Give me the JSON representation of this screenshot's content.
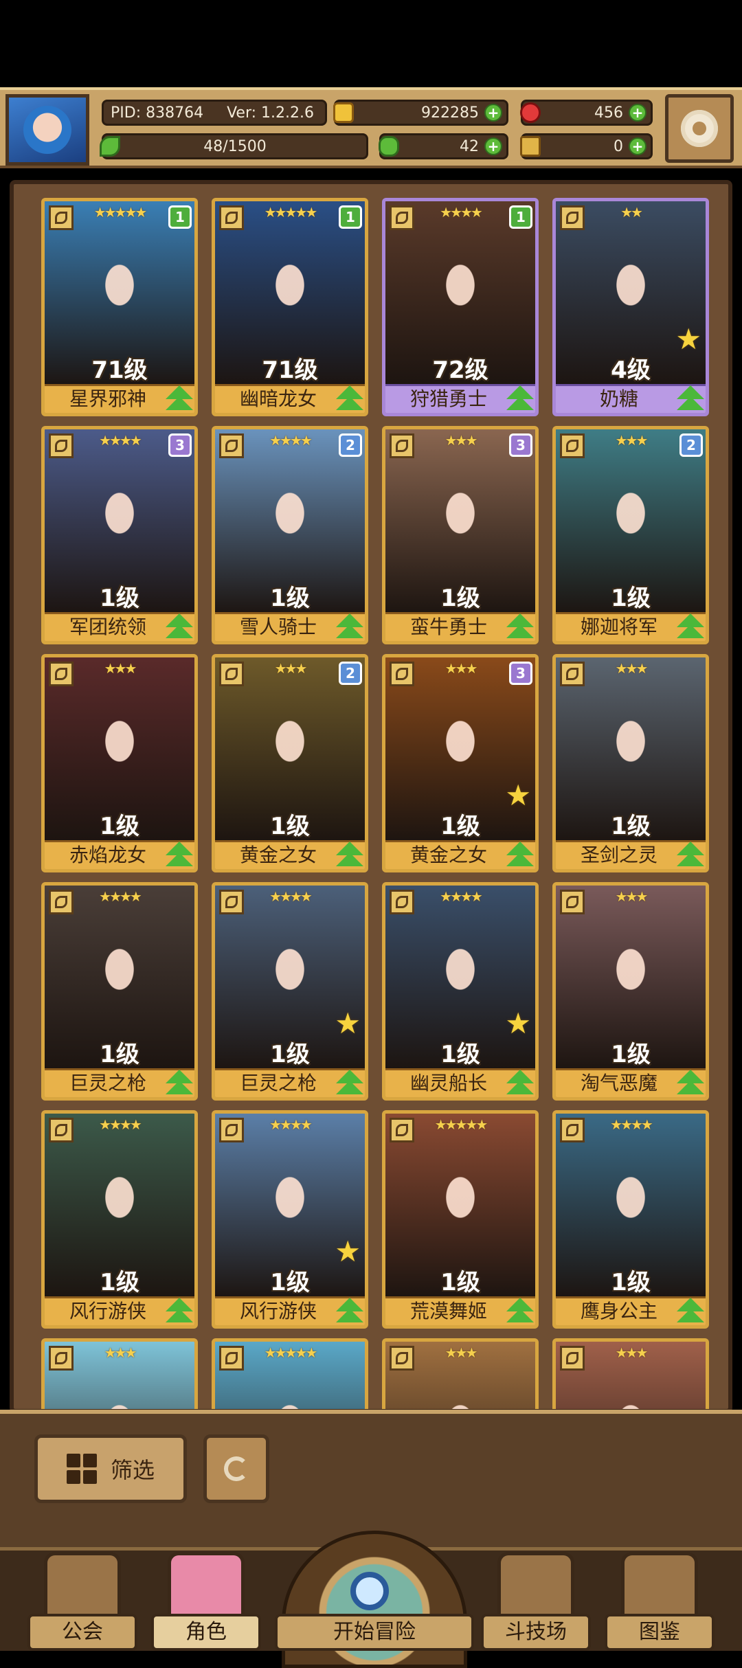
{
  "header": {
    "pid": "PID: 838764",
    "version": "Ver: 1.2.2.6",
    "gold": "922285",
    "ruby": "456",
    "energy": "48/1500",
    "energy_fraction": 0.032,
    "clover": "42",
    "token": "0"
  },
  "cards": [
    {
      "name": "星界邪神",
      "level": "71级",
      "stars": "★★★★★",
      "badge": "1",
      "rarity": "gold",
      "bg": "#3a7fb5"
    },
    {
      "name": "幽暗龙女",
      "level": "71级",
      "stars": "★★★★★",
      "badge": "1",
      "rarity": "gold",
      "bg": "#2a4f86"
    },
    {
      "name": "狩猎勇士",
      "level": "72级",
      "stars": "★★★★",
      "badge": "1",
      "rarity": "purple",
      "bg": "#5a3a2a"
    },
    {
      "name": "奶糖",
      "level": "4级",
      "stars": "★★",
      "badge": "",
      "rarity": "purple",
      "bg": "#3b4c62"
    },
    {
      "name": "军团统领",
      "level": "1级",
      "stars": "★★★★",
      "badge": "3",
      "rarity": "gold",
      "bg": "#4c5b8a"
    },
    {
      "name": "雪人骑士",
      "level": "1级",
      "stars": "★★★★",
      "badge": "2",
      "rarity": "gold",
      "bg": "#6a93bd"
    },
    {
      "name": "蛮牛勇士",
      "level": "1级",
      "stars": "★★★",
      "badge": "3",
      "rarity": "gold",
      "bg": "#8a6650"
    },
    {
      "name": "娜迦将军",
      "level": "1级",
      "stars": "★★★",
      "badge": "2",
      "rarity": "gold",
      "bg": "#3f7d86"
    },
    {
      "name": "赤焰龙女",
      "level": "1级",
      "stars": "★★★",
      "badge": "",
      "rarity": "gold",
      "bg": "#5a2a2a"
    },
    {
      "name": "黄金之女",
      "level": "1级",
      "stars": "★★★",
      "badge": "2",
      "rarity": "gold",
      "bg": "#6e5a2a"
    },
    {
      "name": "黄金之女",
      "level": "1级",
      "stars": "★★★",
      "badge": "3",
      "rarity": "gold",
      "bg": "#8a4a1a"
    },
    {
      "name": "圣剑之灵",
      "level": "1级",
      "stars": "★★★",
      "badge": "",
      "rarity": "gold",
      "bg": "#5b6570"
    },
    {
      "name": "巨灵之枪",
      "level": "1级",
      "stars": "★★★★",
      "badge": "",
      "rarity": "gold",
      "bg": "#4a3e38"
    },
    {
      "name": "巨灵之枪",
      "level": "1级",
      "stars": "★★★★",
      "badge": "",
      "rarity": "gold",
      "bg": "#4c607a"
    },
    {
      "name": "幽灵船长",
      "level": "1级",
      "stars": "★★★★",
      "badge": "",
      "rarity": "gold",
      "bg": "#3a4f6a"
    },
    {
      "name": "淘气恶魔",
      "level": "1级",
      "stars": "★★★",
      "badge": "",
      "rarity": "gold",
      "bg": "#7a5a5a"
    },
    {
      "name": "风行游侠",
      "level": "1级",
      "stars": "★★★★",
      "badge": "",
      "rarity": "gold",
      "bg": "#3c5a4a"
    },
    {
      "name": "风行游侠",
      "level": "1级",
      "stars": "★★★★",
      "badge": "",
      "rarity": "gold",
      "bg": "#5b7fa8"
    },
    {
      "name": "荒漠舞姬",
      "level": "1级",
      "stars": "★★★★★",
      "badge": "",
      "rarity": "gold",
      "bg": "#8a4a32"
    },
    {
      "name": "鹰身公主",
      "level": "1级",
      "stars": "★★★★",
      "badge": "",
      "rarity": "gold",
      "bg": "#3a6a86"
    },
    {
      "name": "",
      "level": "",
      "stars": "★★★",
      "badge": "",
      "rarity": "gold",
      "bg": "#7ec3d8"
    },
    {
      "name": "",
      "level": "",
      "stars": "★★★★★",
      "badge": "",
      "rarity": "gold",
      "bg": "#5aa8c8"
    },
    {
      "name": "",
      "level": "",
      "stars": "★★★",
      "badge": "",
      "rarity": "gold",
      "bg": "#a07040"
    },
    {
      "name": "",
      "level": "",
      "stars": "★★★",
      "badge": "",
      "rarity": "gold",
      "bg": "#a0604a"
    }
  ],
  "card_extras": {
    "gold_star_cards": [
      3,
      10,
      13,
      14,
      17
    ]
  },
  "badge_colors": {
    "1": "#4eae3c",
    "2": "#5b8fd6",
    "3": "#9a78d0"
  },
  "filter_label": "筛选",
  "nav": {
    "guild": "公会",
    "character": "角色",
    "adventure": "开始冒险",
    "arena": "斗技场",
    "codex": "图鉴"
  }
}
